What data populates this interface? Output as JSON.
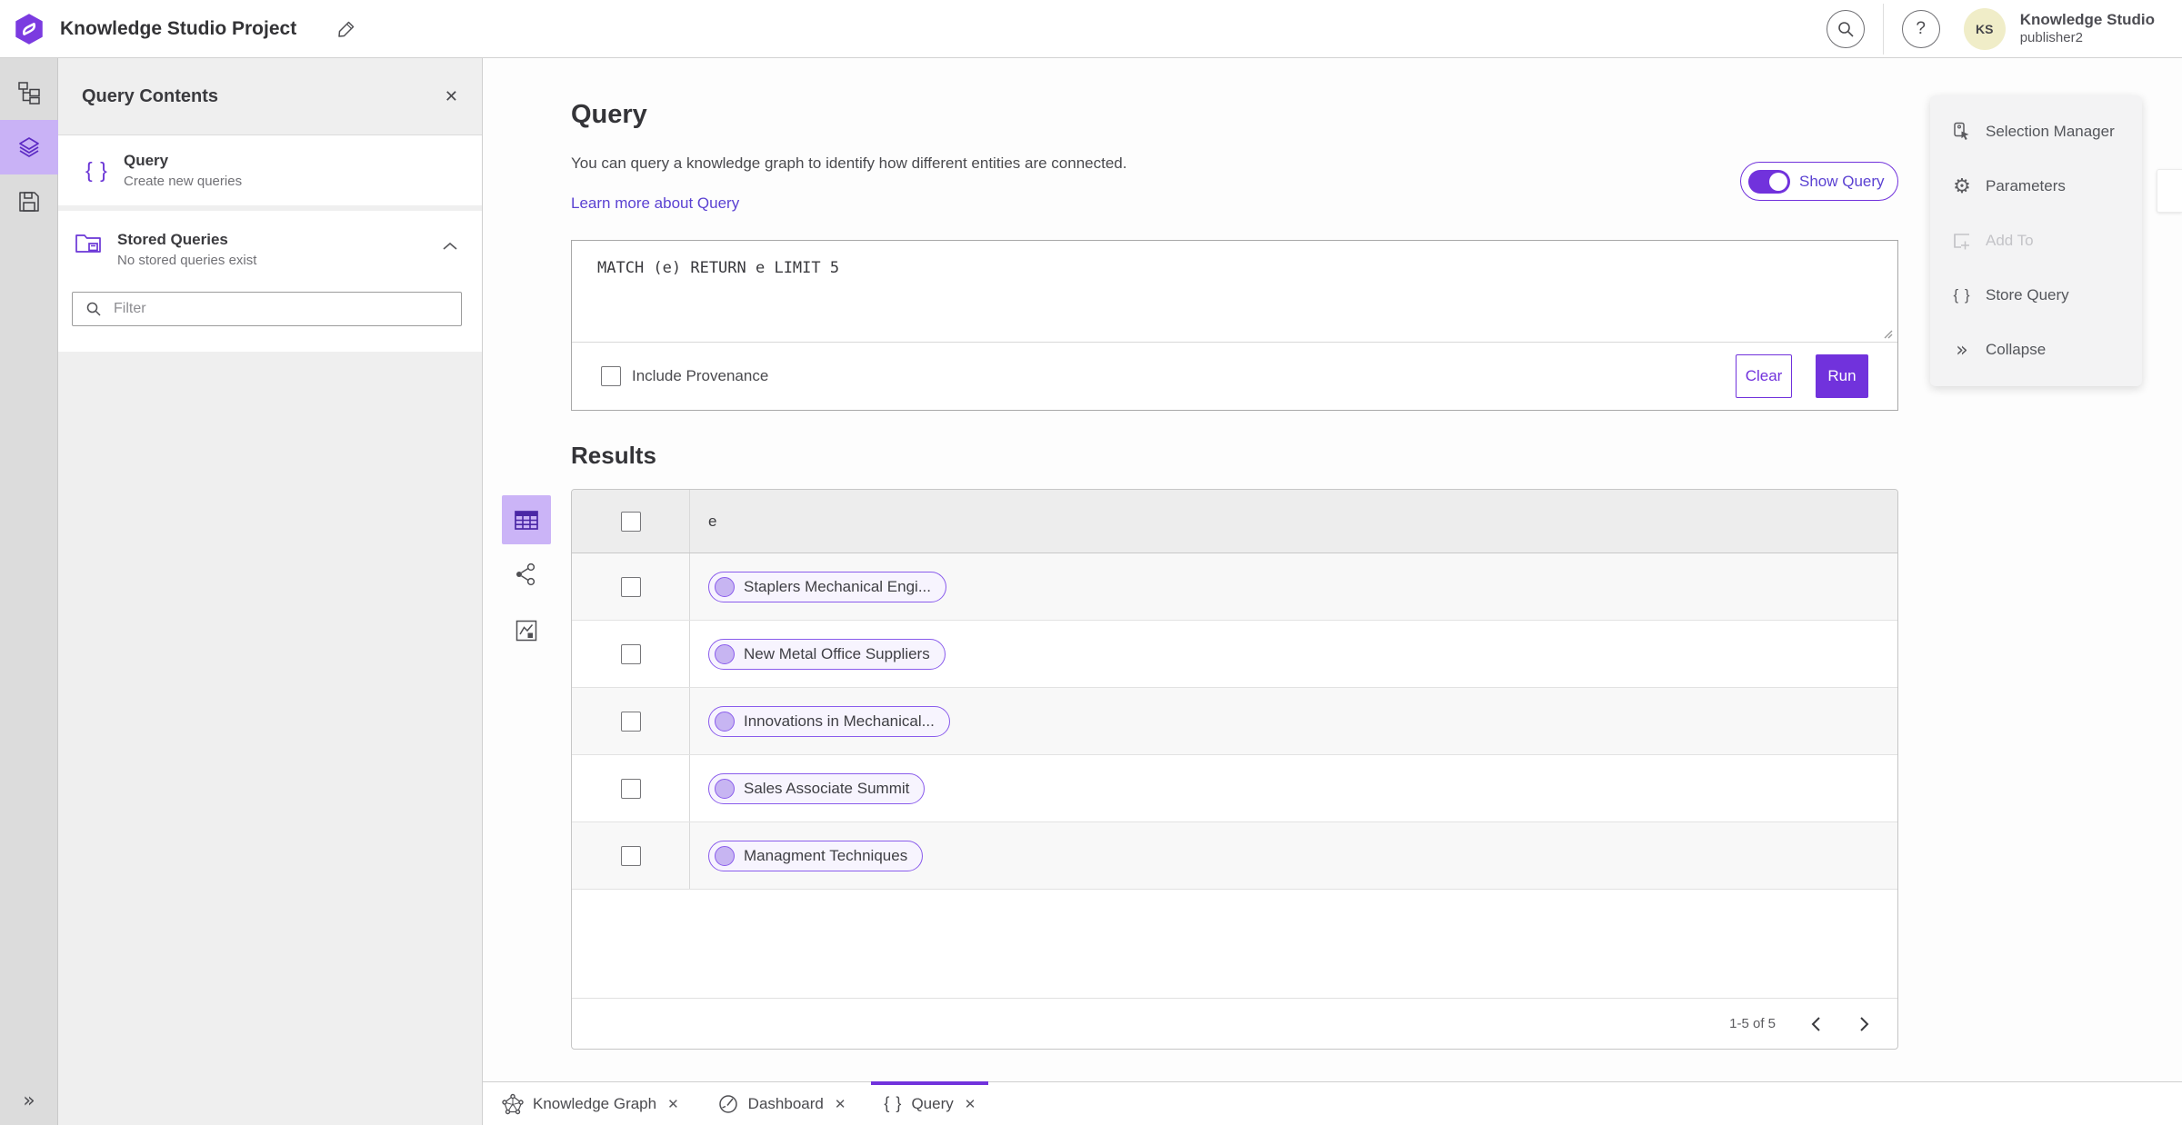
{
  "app": {
    "title": "Knowledge Studio Project"
  },
  "topbar": {
    "user_initials": "KS",
    "user_org": "Knowledge Studio",
    "user_name": "publisher2"
  },
  "left_panel": {
    "title": "Query Contents",
    "items": [
      {
        "title": "Query",
        "subtitle": "Create new queries"
      },
      {
        "title": "Stored Queries",
        "subtitle": "No stored queries exist"
      }
    ],
    "filter_placeholder": "Filter"
  },
  "query_section": {
    "heading": "Query",
    "description": "You can query a knowledge graph to identify how different entities are connected.",
    "link": "Learn more about Query",
    "toggle_label": "Show Query",
    "query_text": "MATCH (e) RETURN e LIMIT 5",
    "provenance_label": "Include Provenance",
    "clear_label": "Clear",
    "run_label": "Run"
  },
  "results": {
    "heading": "Results",
    "column_header": "e",
    "rows": [
      "Staplers Mechanical Engi...",
      "New Metal Office Suppliers",
      "Innovations in Mechanical...",
      "Sales Associate Summit",
      "Managment Techniques"
    ],
    "pagination": "1-5 of 5"
  },
  "context_menu": {
    "items": [
      {
        "label": "Selection Manager"
      },
      {
        "label": "Parameters"
      },
      {
        "label": "Add To"
      },
      {
        "label": "Store Query"
      },
      {
        "label": "Collapse"
      }
    ]
  },
  "tabs": [
    {
      "label": "Knowledge Graph"
    },
    {
      "label": "Dashboard"
    },
    {
      "label": "Query"
    }
  ],
  "icons": {
    "close": "✕",
    "help": "?",
    "gear": "⚙",
    "braces": "{ }",
    "collapse": "»",
    "expand": "»"
  },
  "colors": {
    "accent": "#7132dc",
    "accent_light": "#c9b2f6",
    "chip_border": "#8a5cec",
    "chip_bg": "#f7f4fe",
    "avatar_bg": "#f0edc8",
    "sidebar_bg": "#dcdcdc",
    "panel_bg": "#efefef"
  }
}
